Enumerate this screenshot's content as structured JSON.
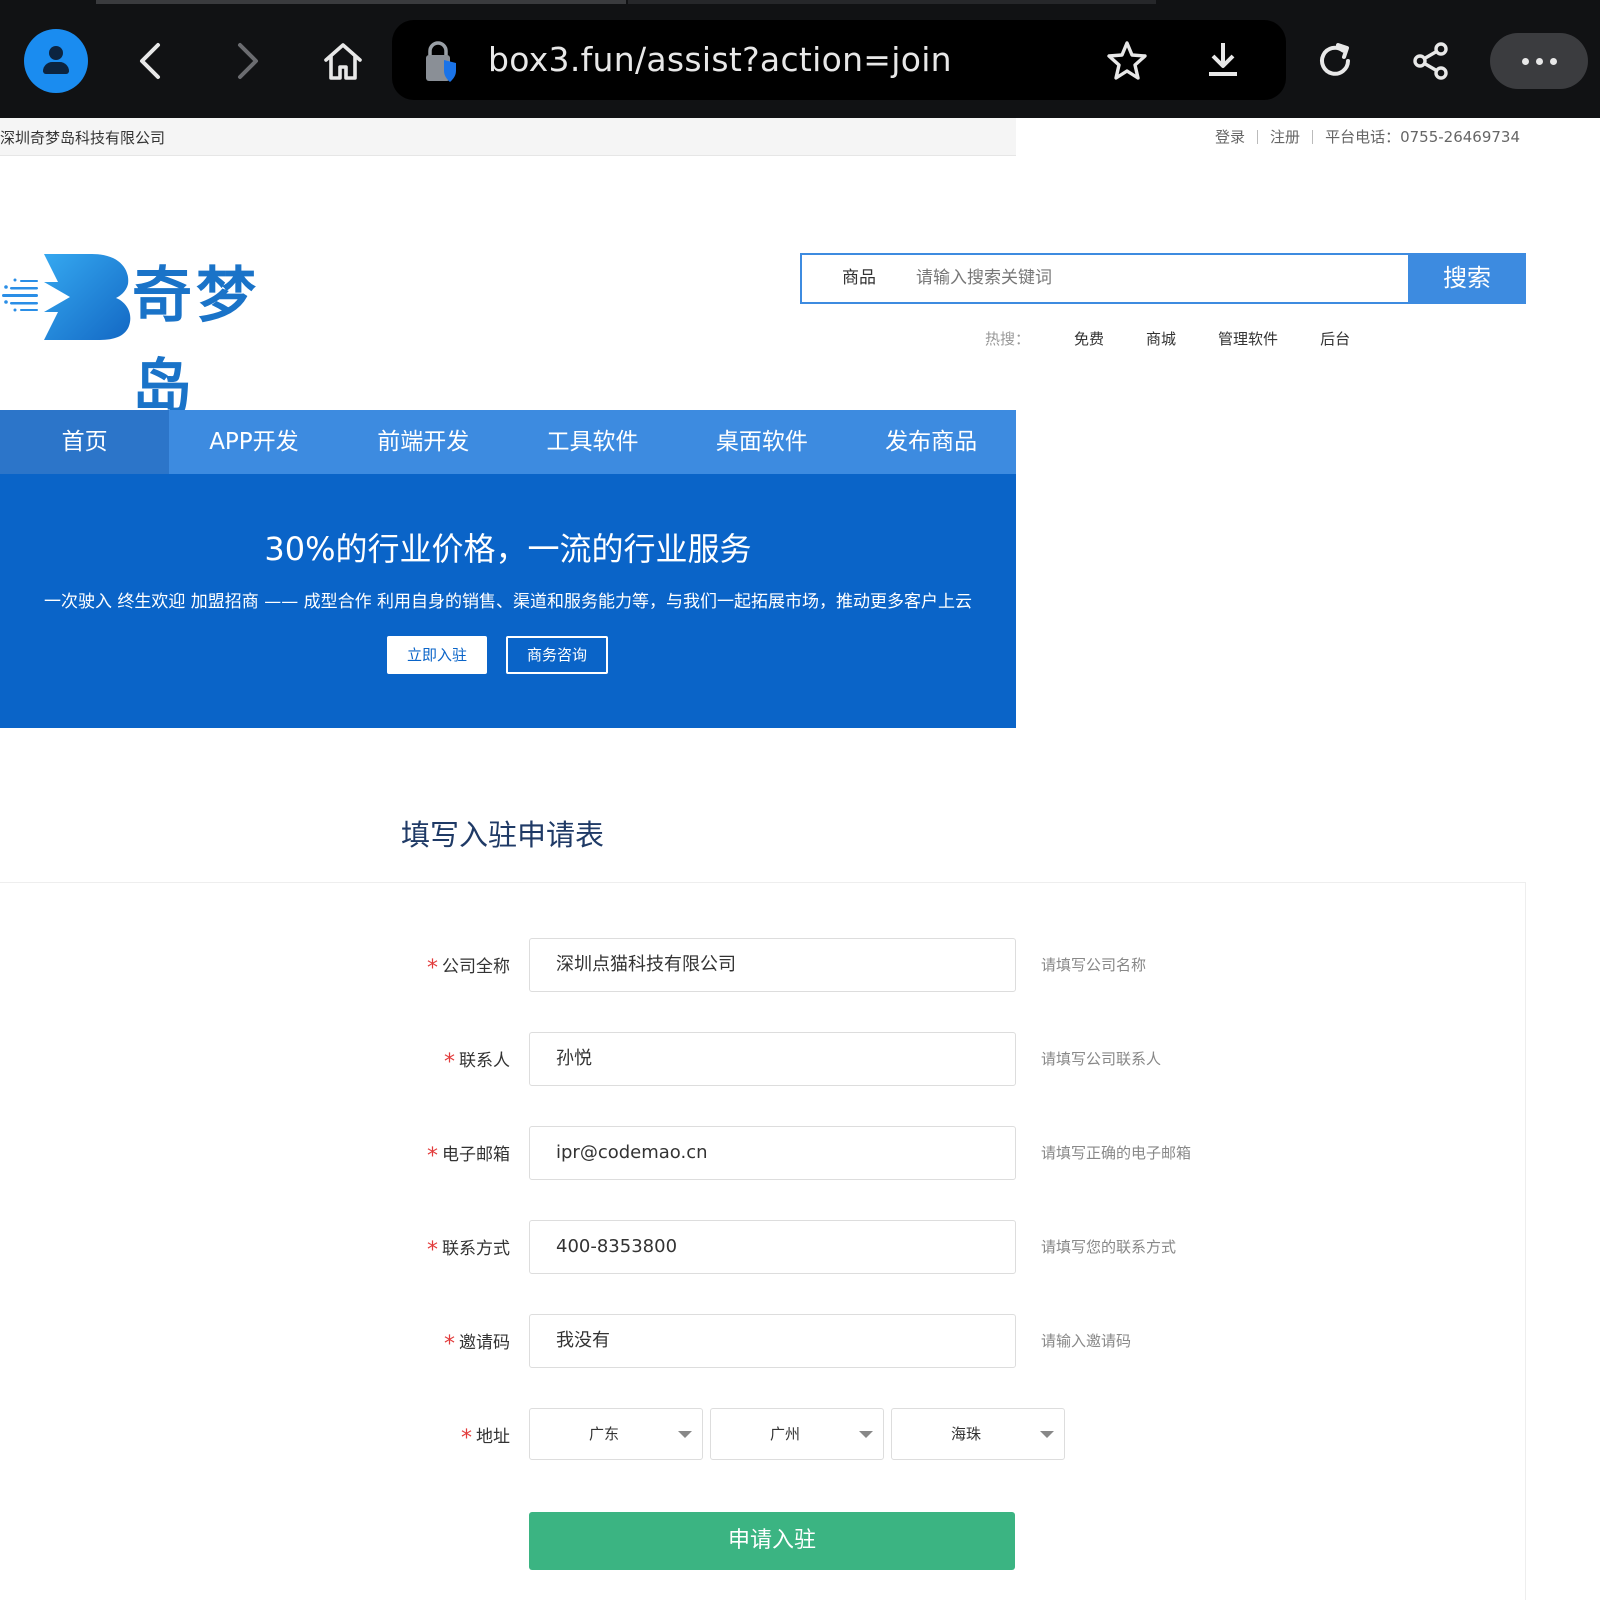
{
  "browser": {
    "url": "box3.fun/assist?action=join",
    "icons": [
      "profile-avatar-icon",
      "back-arrow-icon",
      "forward-arrow-icon",
      "home-icon",
      "lock-shield-icon",
      "bookmark-star-icon",
      "download-icon",
      "reload-icon",
      "share-icon",
      "more-menu-icon"
    ]
  },
  "topbar": {
    "company": "深圳奇梦岛科技有限公司",
    "login": "登录",
    "register": "注册",
    "phone": "平台电话：0755-26469734"
  },
  "logo": {
    "text": "奇梦岛"
  },
  "search": {
    "category": "商品",
    "placeholder": "请输入搜索关键词",
    "button": "搜索",
    "hot_label": "热搜：",
    "hot_items": [
      "免费",
      "商城",
      "管理软件",
      "后台"
    ]
  },
  "nav": {
    "items": [
      "首页",
      "APP开发",
      "前端开发",
      "工具软件",
      "桌面软件",
      "发布商品"
    ],
    "active_index": 0
  },
  "banner": {
    "title": "30%的行业价格，一流的行业服务",
    "subtitle": "一次驶入 终生欢迎 加盟招商 —— 成型合作 利用自身的销售、渠道和服务能力等，与我们一起拓展市场，推动更多客户上云",
    "primary_button": "立即入驻",
    "secondary_button": "商务咨询"
  },
  "form": {
    "title": "填写入驻申请表",
    "required_mark": "*",
    "fields": [
      {
        "label": "公司全称",
        "value": "深圳点猫科技有限公司",
        "hint": "请填写公司名称"
      },
      {
        "label": "联系人",
        "value": "孙悦",
        "hint": "请填写公司联系人"
      },
      {
        "label": "电子邮箱",
        "value": "ipr@codemao.cn",
        "hint": "请填写正确的电子邮箱"
      },
      {
        "label": "联系方式",
        "value": "400-8353800",
        "hint": "请填写您的联系方式"
      },
      {
        "label": "邀请码",
        "value": "我没有",
        "hint": "请输入邀请码"
      }
    ],
    "address": {
      "label": "地址",
      "province": "广东",
      "city": "广州",
      "district": "海珠"
    },
    "submit": "申请入驻"
  },
  "colors": {
    "brand_blue": "#3d8be0",
    "banner_blue": "#0a64c8",
    "submit_green": "#3bb482",
    "required_red": "#e23c3c"
  }
}
